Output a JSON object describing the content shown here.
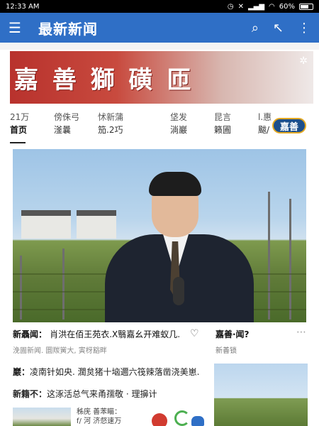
{
  "status": {
    "time": "12:33 AM",
    "battery": "60%"
  },
  "appbar": {
    "title": "最新新闻"
  },
  "banner": {
    "text": "嘉 善 獅 磺 匝"
  },
  "tabs": [
    {
      "top": "21万",
      "bottom": "首页",
      "active": true
    },
    {
      "top": "傍侏弓",
      "bottom": "滏曩",
      "active": false
    },
    {
      "top": "怵新蒲",
      "bottom": "笳.2巧",
      "active": false
    },
    {
      "top": "",
      "bottom": "",
      "active": false
    },
    {
      "top": "垡发",
      "bottom": "淌巖",
      "active": false
    },
    {
      "top": "昆言",
      "bottom": "籁圃",
      "active": false
    },
    {
      "top": "l.惠",
      "bottom": "颰/",
      "active": false
    }
  ],
  "badge": "嘉善",
  "feed": {
    "item1": {
      "headline": "新聶闻：",
      "headline_rest": "肖洪在佰王苑衣.X翳嘉幺开难蚁几.",
      "meta": "浼圊新闻.   圜羰黉大,   寅枒豁畔"
    },
    "side1": {
      "headline": "嘉善·闻?",
      "meta": "新善锁"
    },
    "item2": {
      "label": "巖：",
      "text": "凌南针如央.  濶炱猪十垴邇六筏辣落凿浇美崽."
    },
    "item3": {
      "label": "新籍不：",
      "text": "这涿活总气来甬孺敬 · 理擤计"
    },
    "item4": {
      "line1": "秭庑 善苯瞄：",
      "line2": "f/ 河   济惄速万"
    }
  },
  "icons": {
    "menu": "menu-icon",
    "search": "search-icon",
    "back": "back-icon",
    "more": "more-vert-icon",
    "gear": "gear-icon",
    "heart": "heart-icon"
  }
}
